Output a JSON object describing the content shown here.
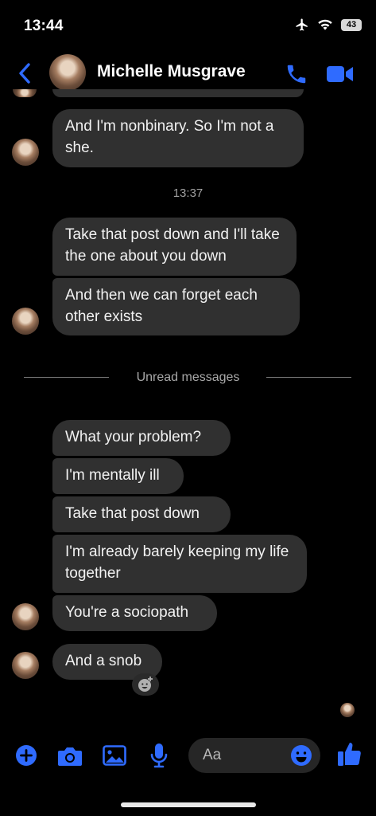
{
  "status_bar": {
    "time": "13:44",
    "battery": "43"
  },
  "header": {
    "contact_name": "Michelle Musgrave"
  },
  "conversation": {
    "messages_top": [
      {
        "text": "And I'm nonbinary. So I'm not a she."
      }
    ],
    "timestamp": "13:37",
    "messages_mid": [
      {
        "text": "Take that post down and I'll take the one about you down"
      },
      {
        "text": "And then we can forget each other exists"
      }
    ],
    "unread_label": "Unread messages",
    "messages_unread": [
      {
        "text": "What your problem?"
      },
      {
        "text": "I'm mentally ill"
      },
      {
        "text": "Take that post down"
      },
      {
        "text": "I'm already barely keeping my life together"
      },
      {
        "text": "You're a sociopath"
      },
      {
        "text": "And a snob"
      }
    ]
  },
  "composer": {
    "placeholder": "Aa"
  },
  "colors": {
    "accent": "#2f6bff",
    "bubble": "#303030",
    "background": "#000000"
  },
  "icons": [
    "back-chevron-icon",
    "phone-icon",
    "video-icon",
    "plus-icon",
    "camera-icon",
    "gallery-icon",
    "mic-icon",
    "emoji-icon",
    "thumbs-up-icon",
    "add-reaction-icon",
    "airplane-icon",
    "wifi-icon"
  ]
}
